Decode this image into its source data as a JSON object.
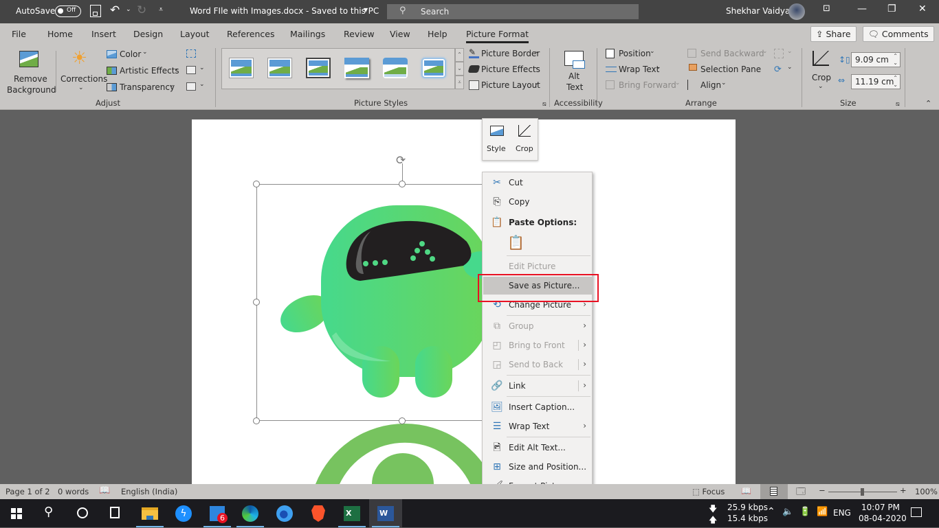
{
  "titlebar": {
    "autosave_label": "AutoSave",
    "autosave_state": "Off",
    "doc_title": "Word FIle with Images.docx  -  Saved to this PC",
    "search_placeholder": "Search",
    "user_name": "Shekhar Vaidya",
    "icons": [
      "save-icon",
      "undo-icon",
      "redo-icon",
      "customize-qat-icon",
      "ribbon-display-icon",
      "minimize-icon",
      "restore-icon",
      "close-icon"
    ]
  },
  "tabs": {
    "items": [
      "File",
      "Home",
      "Insert",
      "Design",
      "Layout",
      "References",
      "Mailings",
      "Review",
      "View",
      "Help",
      "Picture Format"
    ],
    "active": "Picture Format",
    "share_label": "Share",
    "comments_label": "Comments"
  },
  "ribbon": {
    "adjust": {
      "group_label": "Adjust",
      "remove_bg_line1": "Remove",
      "remove_bg_line2": "Background",
      "corrections": "Corrections",
      "color": "Color",
      "artistic_effects": "Artistic Effects",
      "transparency": "Transparency"
    },
    "picture_styles": {
      "group_label": "Picture Styles",
      "gallery_count": 6,
      "picture_border": "Picture Border",
      "picture_effects": "Picture Effects",
      "picture_layout": "Picture Layout"
    },
    "accessibility": {
      "group_label": "Accessibility",
      "alt_text_line1": "Alt",
      "alt_text_line2": "Text"
    },
    "arrange": {
      "group_label": "Arrange",
      "position": "Position",
      "wrap_text": "Wrap Text",
      "bring_forward": "Bring Forward",
      "send_backward": "Send Backward",
      "selection_pane": "Selection Pane",
      "align": "Align"
    },
    "size": {
      "group_label": "Size",
      "crop": "Crop",
      "height": "9.09 cm",
      "width": "11.19 cm"
    }
  },
  "mini_toolbar": {
    "style": "Style",
    "crop": "Crop"
  },
  "context_menu": {
    "items": [
      {
        "label": "Cut",
        "icon": "scissors-icon",
        "enabled": true
      },
      {
        "label": "Copy",
        "icon": "copy-icon",
        "enabled": true
      },
      {
        "label": "Paste Options:",
        "icon": "paste-icon",
        "enabled": true,
        "bold": true
      },
      {
        "label": "Edit Picture",
        "enabled": false
      },
      {
        "label": "Save as Picture...",
        "enabled": true,
        "highlighted": true
      },
      {
        "label": "Change Picture",
        "icon": "change-picture-icon",
        "enabled": true,
        "submenu": true
      },
      {
        "label": "Group",
        "icon": "group-icon",
        "enabled": false,
        "submenu": true
      },
      {
        "label": "Bring to Front",
        "icon": "bring-front-icon",
        "enabled": false,
        "submenu": true
      },
      {
        "label": "Send to Back",
        "icon": "send-back-icon",
        "enabled": false,
        "submenu": true
      },
      {
        "label": "Link",
        "icon": "link-icon",
        "enabled": true,
        "submenu": true
      },
      {
        "label": "Insert Caption...",
        "icon": "caption-icon",
        "enabled": true
      },
      {
        "label": "Wrap Text",
        "icon": "wrap-text-icon",
        "enabled": true,
        "submenu": true
      },
      {
        "label": "Edit Alt Text...",
        "icon": "alt-text-icon",
        "enabled": true
      },
      {
        "label": "Size and Position...",
        "icon": "size-position-icon",
        "enabled": true
      },
      {
        "label": "Format Picture...",
        "icon": "format-picture-icon",
        "enabled": true
      }
    ]
  },
  "statusbar": {
    "page": "Page 1 of 2",
    "words": "0 words",
    "language": "English (India)",
    "focus": "Focus",
    "zoom": "100%",
    "zoom_level": 100
  },
  "taskbar": {
    "apps": [
      "Start",
      "Search",
      "Cortana",
      "Task View",
      "File Explorer",
      "Messenger",
      "WhatsApp",
      "Edge",
      "Firefox",
      "Brave",
      "Excel",
      "Word"
    ],
    "whatsapp_badge": "6",
    "net_down": "25.9 kbps",
    "net_up": "15.4 kbps",
    "lang": "ENG",
    "time": "10:07 PM",
    "date": "08-04-2020"
  },
  "colors": {
    "accent_red_highlight": "#e81123",
    "robot_green": "#4fd884",
    "ring_green": "#77c35f"
  }
}
